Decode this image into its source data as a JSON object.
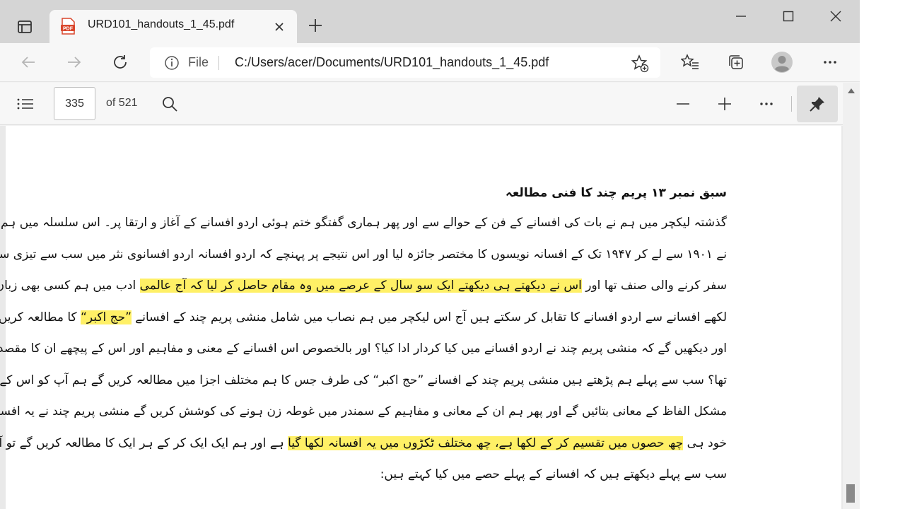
{
  "tab": {
    "title": "URD101_handouts_1_45.pdf",
    "favicon_label": "PDF"
  },
  "address_bar": {
    "scheme_label": "File",
    "url": "C:/Users/acer/Documents/URD101_handouts_1_45.pdf"
  },
  "pdf_toolbar": {
    "page_current": "335",
    "page_total_label": "of 521"
  },
  "document": {
    "heading": "سبق نمبر ۱۳ پریم چند کا فنی مطالعہ",
    "lines": [
      {
        "segments": [
          {
            "text": "گذشتہ لیکچر میں ہم نے بات کی افسانے کے فن کے حوالے سے اور پھر ہماری گفتگو ختم ہوئی اردو افسانے کے آغاز و ارتقا پر۔ اس سلسلہ میں ہم",
            "highlight": false
          }
        ]
      },
      {
        "segments": [
          {
            "text": "نے ۱۹۰۱ سے لے کر ۱۹۴۷ تک کے افسانہ نویسوں کا مختصر جائزہ لیا اور اس نتیجے پر پہنچے کہ اردو افسانہ اردو افسانوی نثر میں سب سے تیزی سے",
            "highlight": false
          }
        ]
      },
      {
        "segments": [
          {
            "text": "سفر کرنے والی صنف تھا اور ",
            "highlight": false
          },
          {
            "text": "اس نے دیکھتے ہی دیکھتے ایک سو سال کے عرصے میں وہ مقام حاصل کر لیا کہ آج عالمی",
            "highlight": true
          },
          {
            "text": " ادب میں ہم کسی بھی زبان میں",
            "highlight": false
          }
        ]
      },
      {
        "segments": [
          {
            "text": "لکھے افسانے سے اردو افسانے کا تقابل کر سکتے ہیں آج اس لیکچر میں ہم نصاب میں شامل منشی پریم چند کے افسانے ",
            "highlight": false
          },
          {
            "text": "”حج اکبر“",
            "highlight": true
          },
          {
            "text": " کا مطالعہ کریں گے",
            "highlight": false
          }
        ]
      },
      {
        "segments": [
          {
            "text": "اور دیکھیں گے کہ منشی پریم چند نے اردو افسانے میں کیا کردار ادا کیا؟ اور بالخصوص اس افسانے کے معنی و مفاہیم اور اس کے پیچھے ان کا مقصد کیا",
            "highlight": false
          }
        ]
      },
      {
        "segments": [
          {
            "text": "تھا؟ سب سے پہلے ہم پڑھتے ہیں منشی پریم چند کے افسانے ”حج اکبر“ کی طرف جس کا ہم مختلف اجزا میں مطالعہ کریں گے ہم آپ کو اس کے",
            "highlight": false
          }
        ]
      },
      {
        "segments": [
          {
            "text": "مشکل الفاظ کے معانی بتائیں گے اور پھر ہم ان کے معانی و مفاہیم کے سمندر میں غوطہ زن ہونے کی کوشش کریں گے منشی پریم چند نے یہ افسانہ",
            "highlight": false
          }
        ]
      },
      {
        "segments": [
          {
            "text": "خود ہی ",
            "highlight": false
          },
          {
            "text": "چھ حصوں میں تقسیم کر کے لکھا ہے، چھ مختلف ٹکڑوں میں یہ افسانہ لکھا گیا",
            "highlight": true
          },
          {
            "text": " ہے اور ہم ایک ایک کر کے ہر ایک کا مطالعہ کریں گے تو آیئے",
            "highlight": false
          }
        ]
      },
      {
        "segments": [
          {
            "text": "سب سے پہلے دیکھتے ہیں کہ افسانے کے پہلے حصے میں کیا کہتے ہیں:",
            "highlight": false
          }
        ]
      }
    ]
  },
  "colors": {
    "highlight": "#fff066",
    "pdf_icon_red": "#d9452b"
  }
}
